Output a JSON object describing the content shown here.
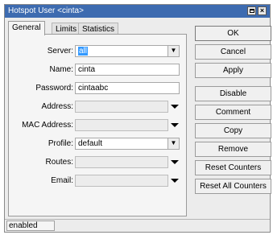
{
  "window": {
    "title": "Hotspot User <cinta>",
    "restore_icon": "restore-icon",
    "close_glyph": "×"
  },
  "tabs": [
    {
      "label": "General",
      "active": true
    },
    {
      "label": "Limits",
      "active": false
    },
    {
      "label": "Statistics",
      "active": false
    }
  ],
  "form": {
    "server": {
      "label": "Server:",
      "value": "all"
    },
    "name": {
      "label": "Name:",
      "value": "cinta"
    },
    "password": {
      "label": "Password:",
      "value": "cintaabc"
    },
    "address": {
      "label": "Address:",
      "value": ""
    },
    "mac_address": {
      "label": "MAC Address:",
      "value": ""
    },
    "profile": {
      "label": "Profile:",
      "value": "default"
    },
    "routes": {
      "label": "Routes:",
      "value": ""
    },
    "email": {
      "label": "Email:",
      "value": ""
    }
  },
  "buttons": {
    "ok": "OK",
    "cancel": "Cancel",
    "apply": "Apply",
    "disable": "Disable",
    "comment": "Comment",
    "copy": "Copy",
    "remove": "Remove",
    "reset_counters": "Reset Counters",
    "reset_all_counters": "Reset All Counters"
  },
  "status": {
    "text": "enabled"
  },
  "colors": {
    "titlebar": "#3d6bb0",
    "selection": "#3399ff"
  }
}
